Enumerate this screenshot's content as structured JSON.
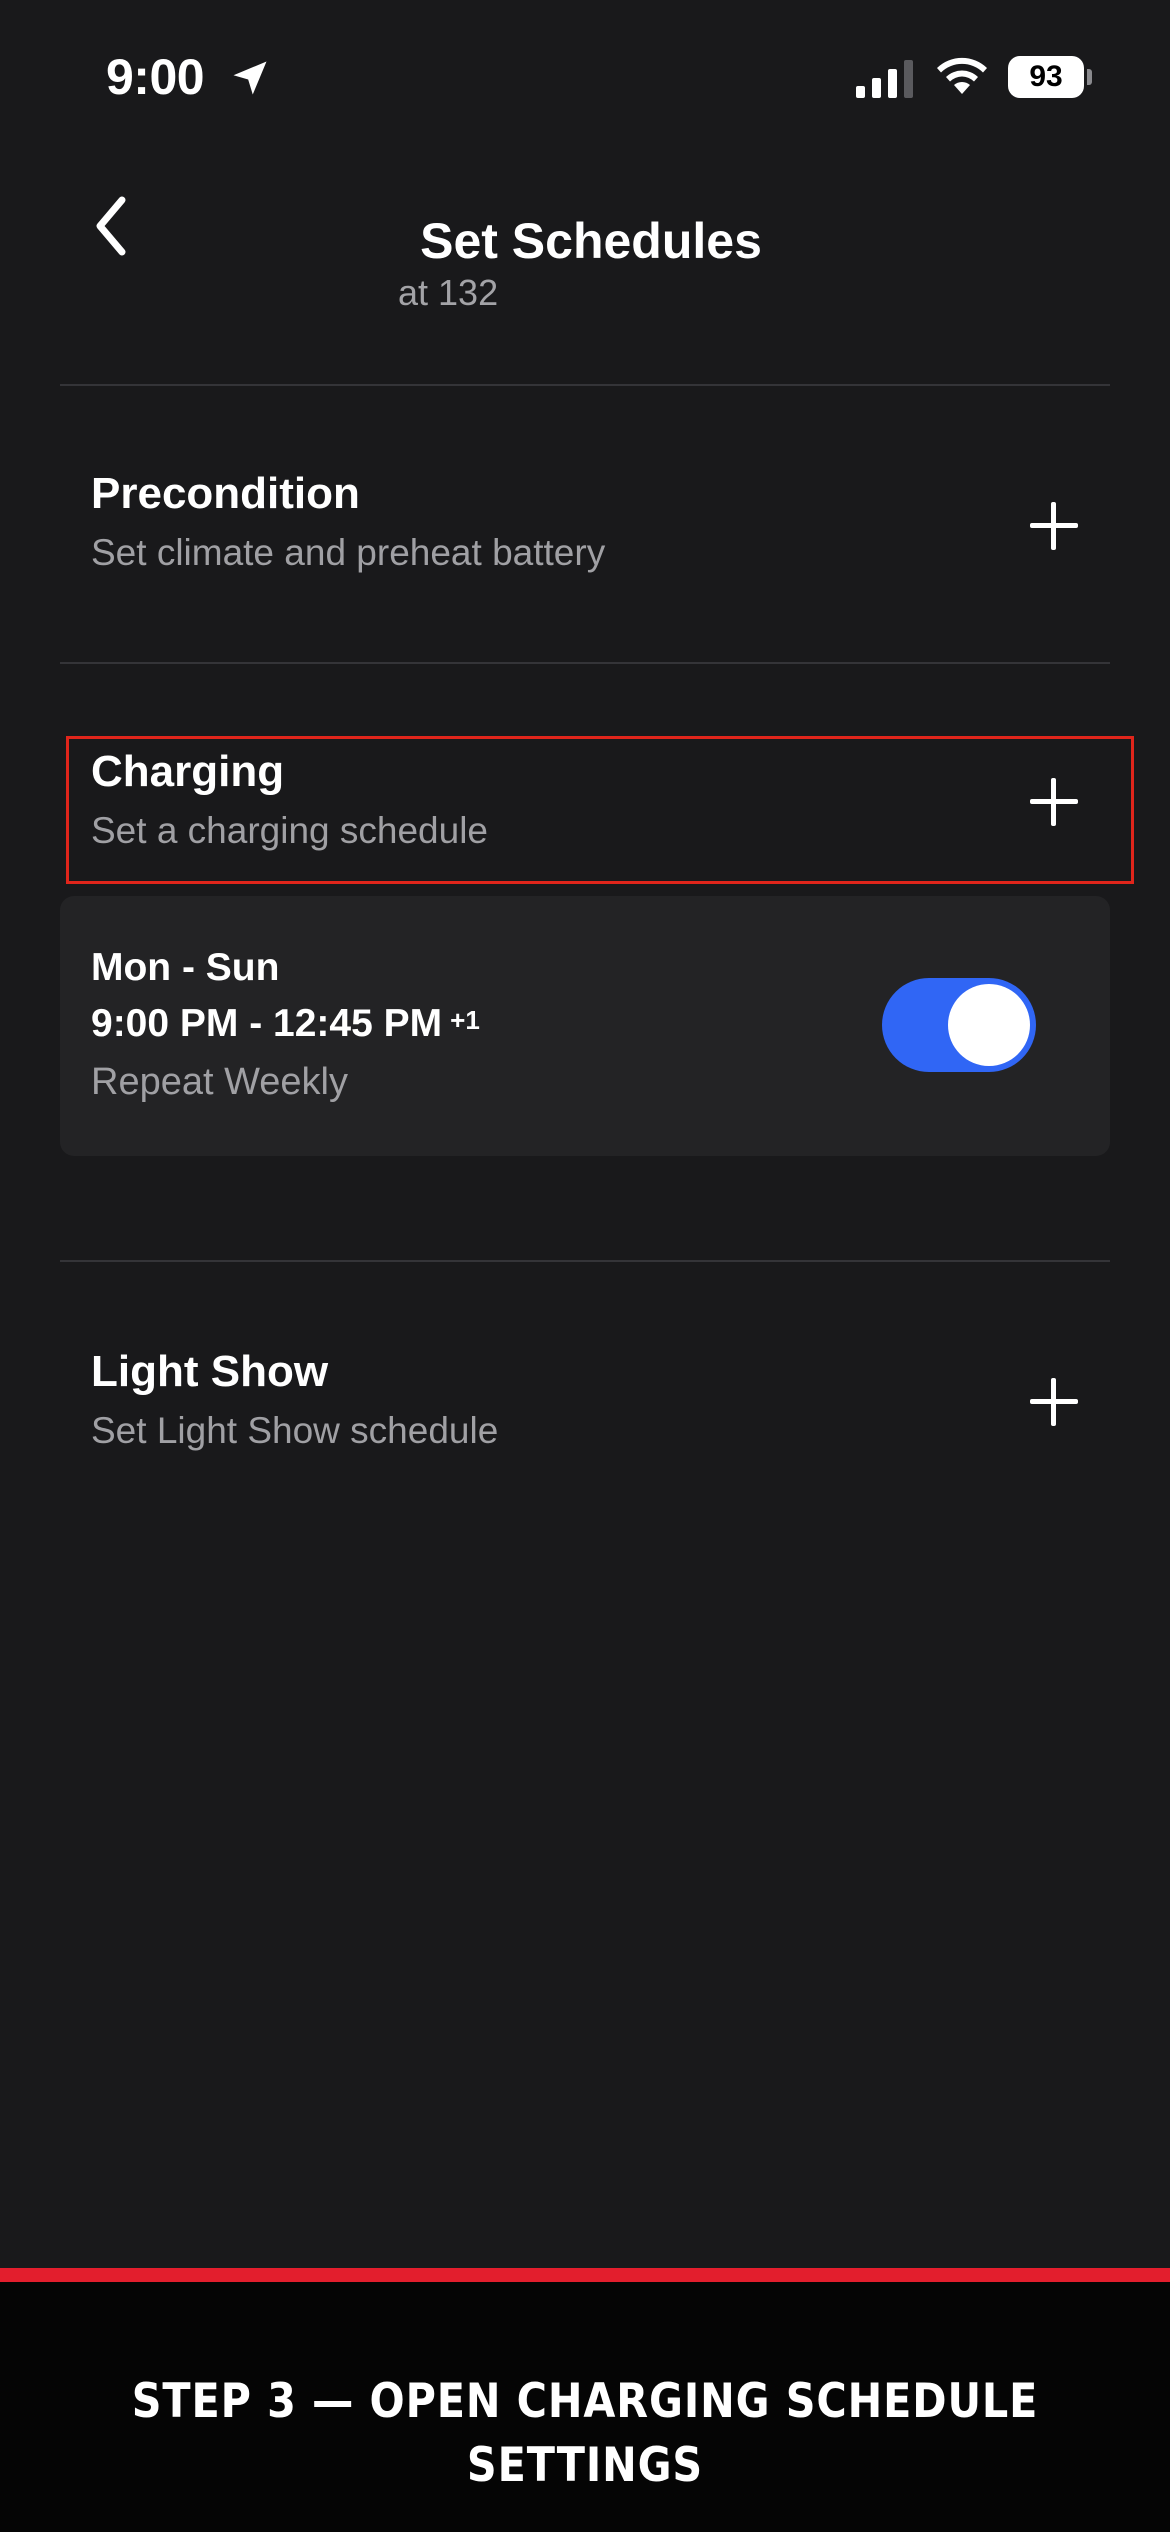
{
  "status_bar": {
    "time": "9:00",
    "battery": "93",
    "icons": [
      "location-arrow-icon",
      "cellular-signal-icon",
      "wifi-icon",
      "battery-icon"
    ]
  },
  "header": {
    "title": "Set Schedules",
    "subtitle": "at 132",
    "back_icon": "chevron-left-icon"
  },
  "sections": {
    "precondition": {
      "title": "Precondition",
      "subtitle": "Set climate and preheat battery",
      "add_icon": "plus-icon"
    },
    "charging": {
      "title": "Charging",
      "subtitle": "Set a charging schedule",
      "add_icon": "plus-icon",
      "schedule": {
        "days": "Mon - Sun",
        "time": "9:00 PM - 12:45 PM",
        "next_day": "+1",
        "repeat": "Repeat Weekly",
        "enabled": true
      }
    },
    "light_show": {
      "title": "Light Show",
      "subtitle": "Set Light Show schedule",
      "add_icon": "plus-icon"
    }
  },
  "banner": {
    "text": "STEP 3 — OPEN CHARGING SCHEDULE SETTINGS"
  },
  "colors": {
    "background": "#19191b",
    "card": "#232325",
    "toggle_on": "#3066f5",
    "highlight": "#e0251b",
    "banner_accent": "#e31e2d",
    "secondary_text": "#a0a0a4"
  }
}
